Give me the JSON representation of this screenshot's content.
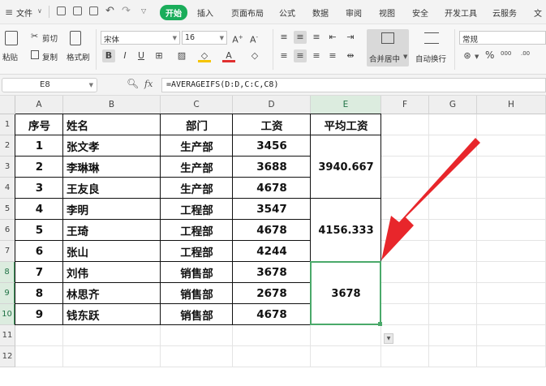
{
  "menubar": {
    "file": "文件",
    "tabs": [
      "开始",
      "插入",
      "页面布局",
      "公式",
      "数据",
      "审阅",
      "视图",
      "安全",
      "开发工具",
      "云服务",
      "文"
    ]
  },
  "ribbon": {
    "paste": "粘贴",
    "cut": "剪切",
    "copy": "复制",
    "format_painter": "格式刷",
    "font_name": "宋体",
    "font_size": "16",
    "merge_center": "合并居中",
    "wrap_text": "自动换行",
    "number_format": "常规",
    "percent": "%",
    "thousands": "000",
    "decimals": ".00"
  },
  "formula_bar": {
    "name_box": "E8",
    "fx": "fx",
    "formula": "=AVERAGEIFS(D:D,C:C,C8)"
  },
  "grid": {
    "columns": [
      "A",
      "B",
      "C",
      "D",
      "E",
      "F",
      "G",
      "H"
    ],
    "rows": [
      "1",
      "2",
      "3",
      "4",
      "5",
      "6",
      "7",
      "8",
      "9",
      "10",
      "11",
      "12"
    ],
    "header": {
      "a": "序号",
      "b": "姓名",
      "c": "部门",
      "d": "工资",
      "e": "平均工资"
    },
    "data": [
      {
        "a": "1",
        "b": "张文孝",
        "c": "生产部",
        "d": "3456"
      },
      {
        "a": "2",
        "b": "李琳琳",
        "c": "生产部",
        "d": "3688"
      },
      {
        "a": "3",
        "b": "王友良",
        "c": "生产部",
        "d": "4678"
      },
      {
        "a": "4",
        "b": "李明",
        "c": "工程部",
        "d": "3547"
      },
      {
        "a": "5",
        "b": "王琦",
        "c": "工程部",
        "d": "4678"
      },
      {
        "a": "6",
        "b": "张山",
        "c": "工程部",
        "d": "4244"
      },
      {
        "a": "7",
        "b": "刘伟",
        "c": "销售部",
        "d": "3678"
      },
      {
        "a": "8",
        "b": "林思齐",
        "c": "销售部",
        "d": "2678"
      },
      {
        "a": "9",
        "b": "钱东跃",
        "c": "销售部",
        "d": "4678"
      }
    ],
    "averages": [
      "3940.667",
      "4156.333",
      "3678"
    ]
  },
  "colors": {
    "accent": "#1aad5a",
    "selection": "#4aa96a",
    "arrow": "#e8262b"
  }
}
